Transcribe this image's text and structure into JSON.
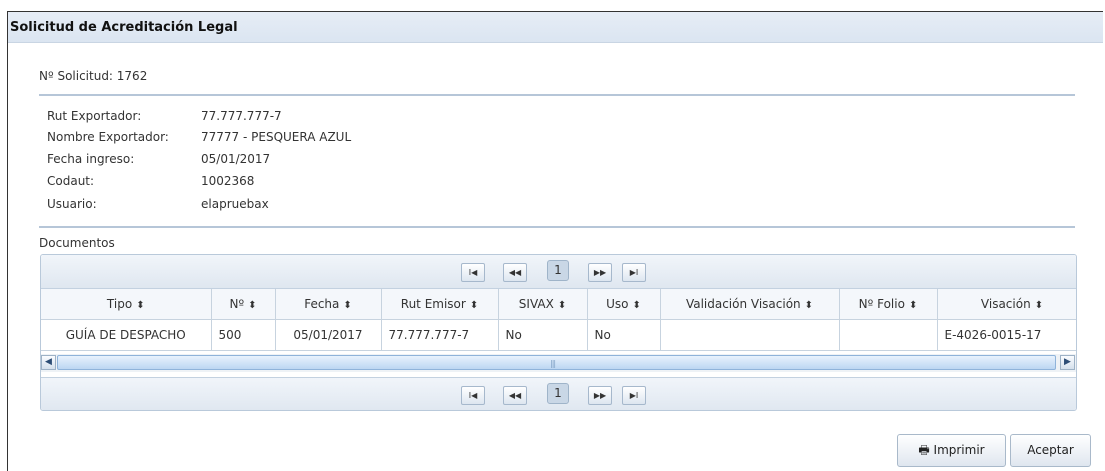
{
  "dialog": {
    "title": "Solicitud de Acreditación Legal"
  },
  "solicitud": {
    "text": "Nº Solicitud: 1762"
  },
  "info": [
    {
      "label": "Rut Exportador:",
      "value": "77.777.777-7"
    },
    {
      "label": "Nombre Exportador:",
      "value": "77777 - PESQUERA AZUL"
    },
    {
      "label": "Fecha ingreso:",
      "value": "05/01/2017"
    },
    {
      "label": "Codaut:",
      "value": "1002368"
    },
    {
      "label": "Usuario:",
      "value": "elapruebax"
    }
  ],
  "documentos": {
    "title": "Documentos",
    "pager": {
      "current_page": "1",
      "first": "I◀",
      "prev": "◀◀",
      "next": "▶▶",
      "last": "▶I"
    },
    "sort_glyph": "⬍",
    "columns": [
      "Tipo",
      "Nº",
      "Fecha",
      "Rut Emisor",
      "SIVAX",
      "Uso",
      "Validación Visación",
      "Nº Folio",
      "Visación"
    ],
    "rows": [
      {
        "tipo": "GUÍA DE DESPACHO",
        "num": "500",
        "fecha": "05/01/2017",
        "rut_emisor": "77.777.777-7",
        "sivax": "No",
        "uso": "No",
        "validacion": "",
        "folio": "",
        "visacion": "E-4026-0015-17"
      }
    ]
  },
  "buttons": {
    "print": "🖶 Imprimir",
    "accept": "Aceptar"
  },
  "icons": {
    "scroll_left": "◀",
    "scroll_right": "▶",
    "grip": "|||"
  }
}
